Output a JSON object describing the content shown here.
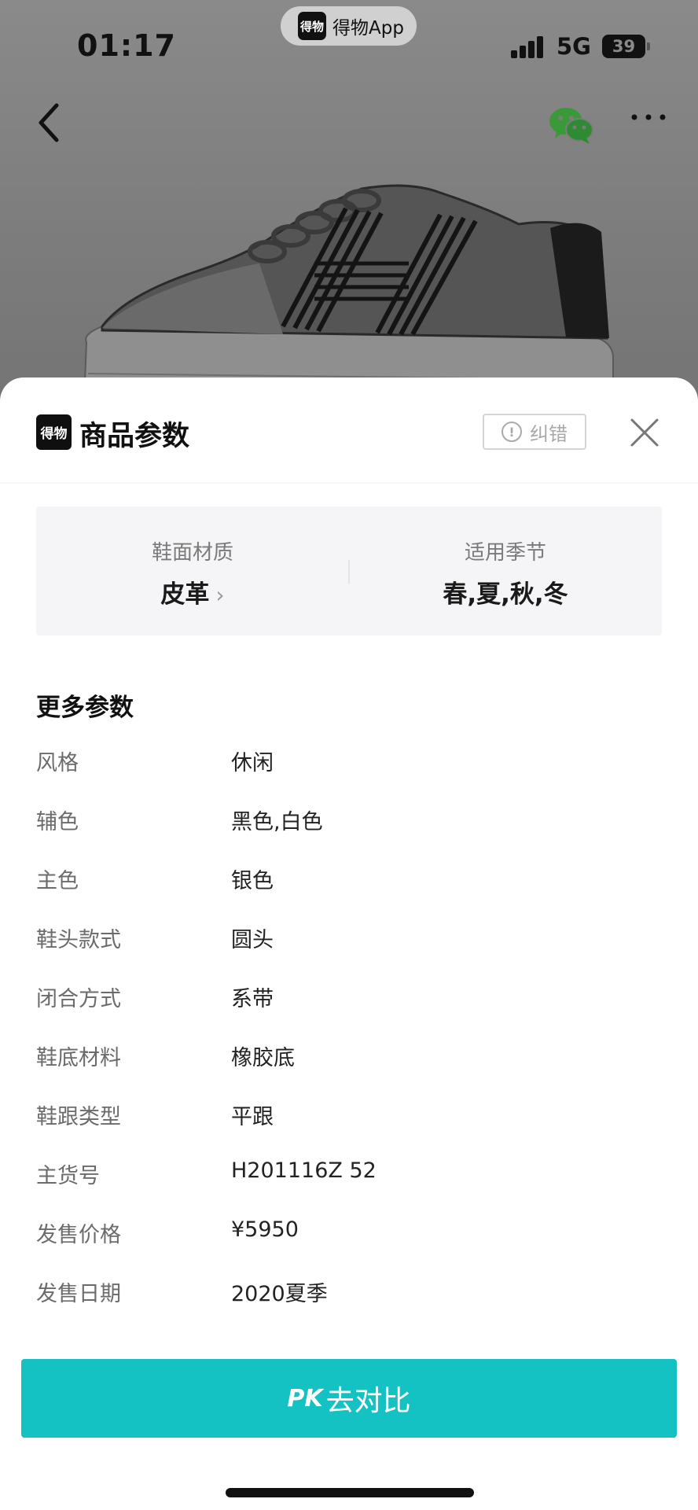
{
  "status_bar": {
    "time": "01:17",
    "app_pill": {
      "logo_text": "得物",
      "name": "得物App"
    },
    "network": "5G",
    "battery": "39"
  },
  "nav": {
    "back_icon": "chevron-left-icon",
    "share_icon": "wechat-icon",
    "more_icon": "more-dots-icon"
  },
  "sheet": {
    "logo_text": "得物",
    "title": "商品参数",
    "correct_label": "纠错",
    "close_icon": "close-icon",
    "key_params": [
      {
        "label": "鞋面材质",
        "value": "皮革",
        "has_chevron": true
      },
      {
        "label": "适用季节",
        "value": "春,夏,秋,冬",
        "has_chevron": false
      }
    ],
    "more_title": "更多参数",
    "params": [
      {
        "key": "风格",
        "value": "休闲"
      },
      {
        "key": "辅色",
        "value": "黑色,白色"
      },
      {
        "key": "主色",
        "value": "银色"
      },
      {
        "key": "鞋头款式",
        "value": "圆头"
      },
      {
        "key": "闭合方式",
        "value": "系带"
      },
      {
        "key": "鞋底材料",
        "value": "橡胶底"
      },
      {
        "key": "鞋跟类型",
        "value": "平跟"
      },
      {
        "key": "主货号",
        "value": "H201116Z 52"
      },
      {
        "key": "发售价格",
        "value": "¥5950"
      },
      {
        "key": "发售日期",
        "value": "2020夏季"
      }
    ],
    "pk_button": {
      "prefix": "PK",
      "label": "去对比"
    },
    "chevron": "›"
  },
  "colors": {
    "accent": "#14c1c3",
    "dim_background": "#7a7a7a",
    "wechat_green": "#3a9a3a"
  }
}
